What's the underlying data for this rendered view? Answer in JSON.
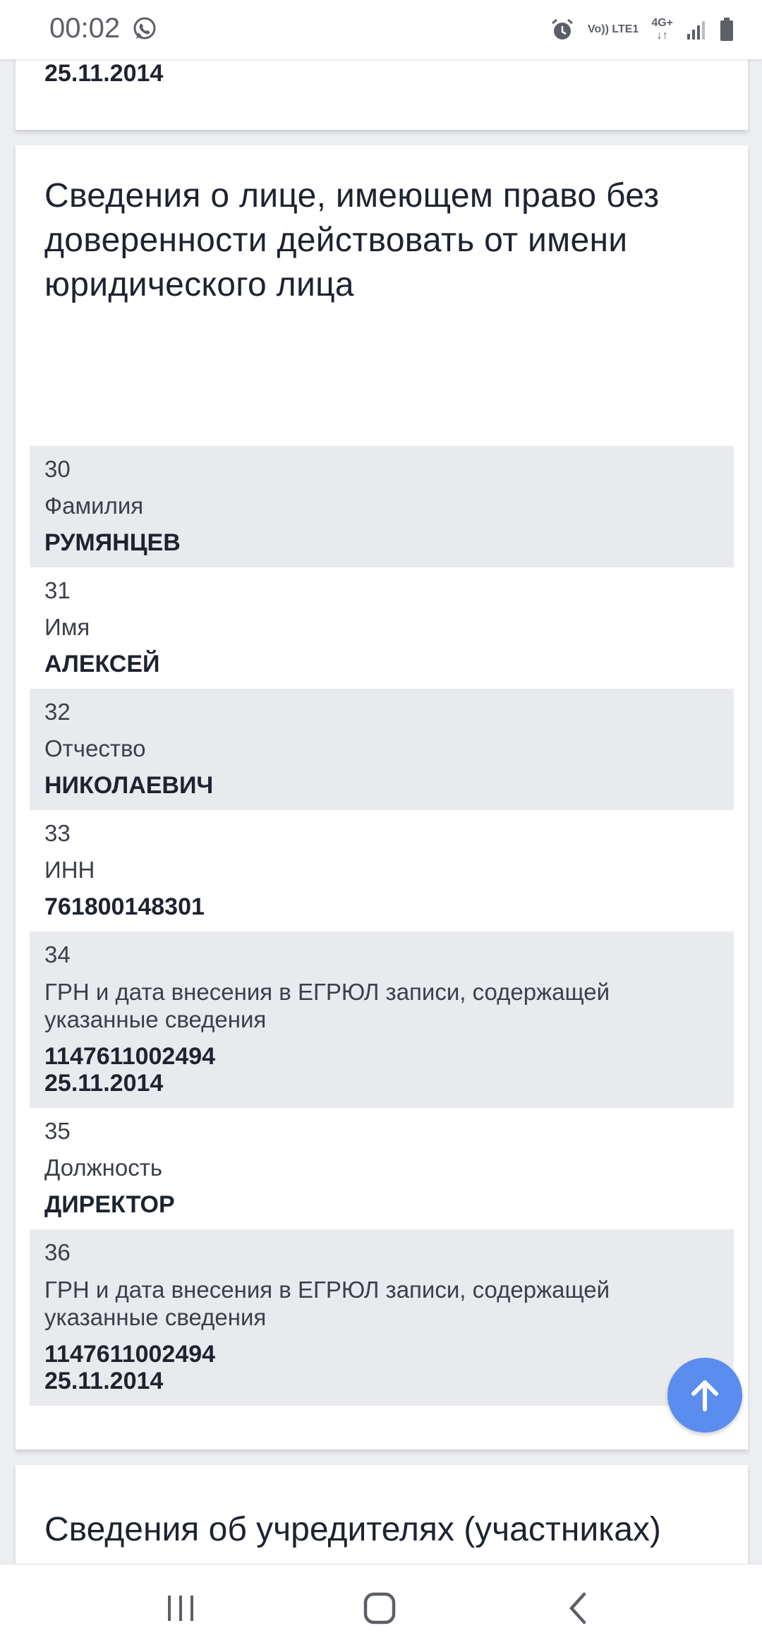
{
  "status": {
    "time": "00:02",
    "net_line1": "Vo)) LTE1",
    "net_line2": "4G+"
  },
  "top_card": {
    "date": "25.11.2014"
  },
  "section": {
    "title": "Сведения о лице, имеющем право без доверенности действовать от имени юридического лица",
    "rows": [
      {
        "num": "30",
        "label": "Фамилия",
        "value": "РУМЯНЦЕВ"
      },
      {
        "num": "31",
        "label": "Имя",
        "value": "АЛЕКСЕЙ"
      },
      {
        "num": "32",
        "label": "Отчество",
        "value": "НИКОЛАЕВИЧ"
      },
      {
        "num": "33",
        "label": "ИНН",
        "value": "761800148301"
      },
      {
        "num": "34",
        "label": "ГРН и дата внесения в ЕГРЮЛ записи, содержащей указанные сведения",
        "value": "1147611002494",
        "value2": "25.11.2014"
      },
      {
        "num": "35",
        "label": "Должность",
        "value": "ДИРЕКТОР"
      },
      {
        "num": "36",
        "label": "ГРН и дата внесения в ЕГРЮЛ записи, содержащей указанные сведения",
        "value": "1147611002494",
        "value2": "25.11.2014"
      }
    ]
  },
  "next_section": {
    "title": "Сведения об учредителях (участниках) юридического лица"
  },
  "icons": {
    "fab": "arrow-up-icon",
    "nav": [
      "recent-apps-icon",
      "home-icon",
      "back-icon"
    ]
  },
  "colors": {
    "fab": "#5b8def",
    "shaded_row": "#e9eaed",
    "background": "#eceef1"
  }
}
